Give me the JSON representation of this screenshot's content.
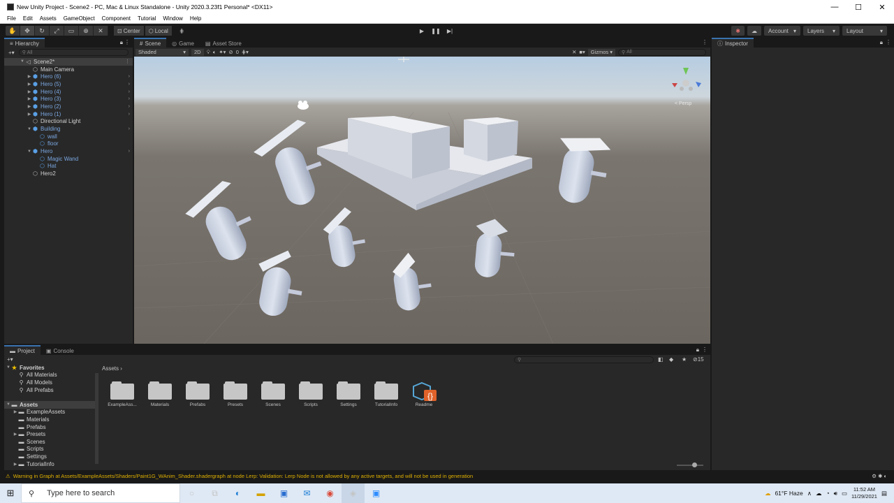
{
  "window": {
    "title": "New Unity Project - Scene2 - PC, Mac & Linux Standalone - Unity 2020.3.23f1 Personal* <DX11>",
    "min": "—",
    "max": "☐",
    "close": "✕"
  },
  "menu": [
    "File",
    "Edit",
    "Assets",
    "GameObject",
    "Component",
    "Tutorial",
    "Window",
    "Help"
  ],
  "toolbar": {
    "center": "Center",
    "local": "Local",
    "account": "Account",
    "layers": "Layers",
    "layout": "Layout"
  },
  "hierarchy": {
    "tab": "Hierarchy",
    "search_placeholder": "All",
    "items": [
      {
        "label": "Scene2*",
        "depth": 0,
        "arrow": "▼",
        "icon": "◁",
        "sel": true,
        "blue": false,
        "more": "⋮"
      },
      {
        "label": "Main Camera",
        "depth": 1,
        "arrow": "",
        "icon": "⬡",
        "blue": false
      },
      {
        "label": "Hero (6)",
        "depth": 1,
        "arrow": "▶",
        "icon": "⬢",
        "blue": true,
        "more": "›"
      },
      {
        "label": "Hero (5)",
        "depth": 1,
        "arrow": "▶",
        "icon": "⬢",
        "blue": true,
        "more": "›"
      },
      {
        "label": "Hero (4)",
        "depth": 1,
        "arrow": "▶",
        "icon": "⬢",
        "blue": true,
        "more": "›"
      },
      {
        "label": "Hero (3)",
        "depth": 1,
        "arrow": "▶",
        "icon": "⬢",
        "blue": true,
        "more": "›"
      },
      {
        "label": "Hero (2)",
        "depth": 1,
        "arrow": "▶",
        "icon": "⬢",
        "blue": true,
        "more": "›"
      },
      {
        "label": "Hero (1)",
        "depth": 1,
        "arrow": "▶",
        "icon": "⬢",
        "blue": true,
        "more": "›"
      },
      {
        "label": "Directional Light",
        "depth": 1,
        "arrow": "",
        "icon": "⬡",
        "blue": false
      },
      {
        "label": "Building",
        "depth": 1,
        "arrow": "▼",
        "icon": "⬢",
        "blue": true,
        "more": "›"
      },
      {
        "label": "wall",
        "depth": 2,
        "arrow": "",
        "icon": "⬡",
        "blue": true
      },
      {
        "label": "floor",
        "depth": 2,
        "arrow": "",
        "icon": "⬡",
        "blue": true
      },
      {
        "label": "Hero",
        "depth": 1,
        "arrow": "▼",
        "icon": "⬢",
        "blue": true,
        "more": "›"
      },
      {
        "label": "Magic Wand",
        "depth": 2,
        "arrow": "",
        "icon": "⬡",
        "blue": true
      },
      {
        "label": "Hat",
        "depth": 2,
        "arrow": "",
        "icon": "⬡",
        "blue": true
      },
      {
        "label": "Hero2",
        "depth": 1,
        "arrow": "",
        "icon": "⬡",
        "blue": false
      }
    ]
  },
  "scene": {
    "tabs": [
      "Scene",
      "Game",
      "Asset Store"
    ],
    "shading": "Shaded",
    "mode2d": "2D",
    "hidden_count": "0",
    "gizmos": "Gizmos",
    "search_placeholder": "All",
    "persp": "< Persp"
  },
  "inspector": {
    "tab": "Inspector"
  },
  "project": {
    "tabs": [
      "Project",
      "Console"
    ],
    "breadcrumb": "Assets",
    "hidden_count": "15",
    "tree": [
      {
        "label": "Favorites",
        "depth": 0,
        "arrow": "▼",
        "icon": "★",
        "bold": true
      },
      {
        "label": "All Materials",
        "depth": 1,
        "arrow": "",
        "icon": "⚲"
      },
      {
        "label": "All Models",
        "depth": 1,
        "arrow": "",
        "icon": "⚲"
      },
      {
        "label": "All Prefabs",
        "depth": 1,
        "arrow": "",
        "icon": "⚲"
      },
      {
        "label": "",
        "depth": 0,
        "arrow": "",
        "icon": ""
      },
      {
        "label": "Assets",
        "depth": 0,
        "arrow": "▼",
        "icon": "▬",
        "bold": true,
        "sel": true
      },
      {
        "label": "ExampleAssets",
        "depth": 1,
        "arrow": "▶",
        "icon": "▬"
      },
      {
        "label": "Materials",
        "depth": 1,
        "arrow": "",
        "icon": "▬"
      },
      {
        "label": "Prefabs",
        "depth": 1,
        "arrow": "",
        "icon": "▬"
      },
      {
        "label": "Presets",
        "depth": 1,
        "arrow": "▶",
        "icon": "▬"
      },
      {
        "label": "Scenes",
        "depth": 1,
        "arrow": "",
        "icon": "▬"
      },
      {
        "label": "Scripts",
        "depth": 1,
        "arrow": "",
        "icon": "▬"
      },
      {
        "label": "Settings",
        "depth": 1,
        "arrow": "",
        "icon": "▬"
      },
      {
        "label": "TutorialInfo",
        "depth": 1,
        "arrow": "▶",
        "icon": "▬"
      }
    ],
    "assets": [
      "ExampleAss...",
      "Materials",
      "Prefabs",
      "Presets",
      "Scenes",
      "Scripts",
      "Settings",
      "TutorialInfo",
      "Readme"
    ]
  },
  "status": {
    "icon": "⚠",
    "text": "Warning in Graph at Assets/ExampleAssets/Shaders/Paint1G_WAnim_Shader.shadergraph at node Lerp: Validation: Lerp Node is not allowed by any active targets, and will not be used in generation"
  },
  "taskbar": {
    "search": "Type here to search",
    "weather": "61°F  Haze",
    "time": "11:52 AM",
    "date": "11/29/2021"
  }
}
